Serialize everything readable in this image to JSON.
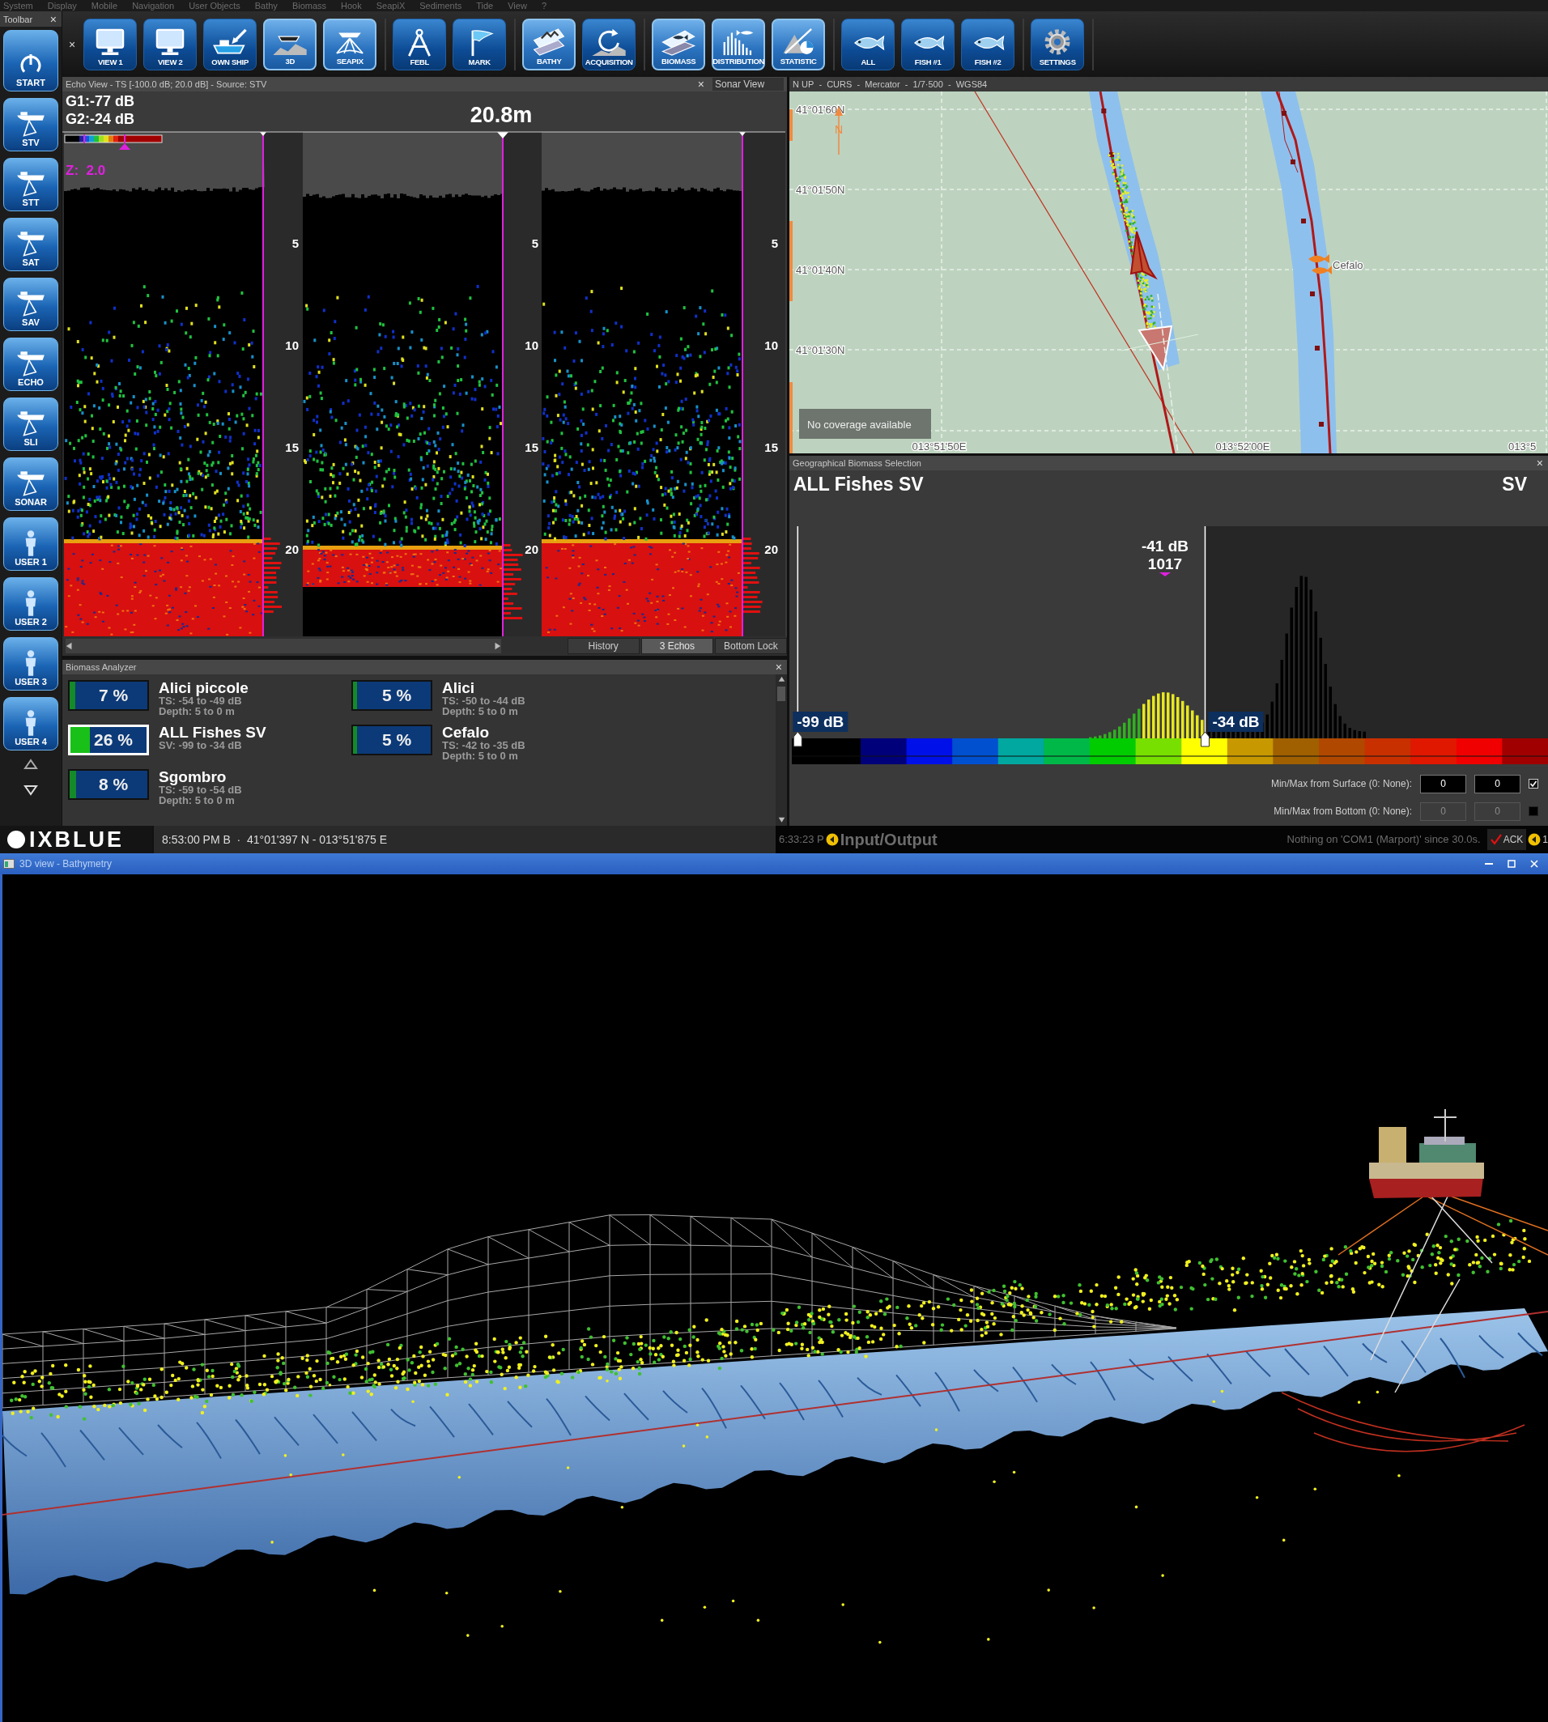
{
  "menu": [
    "System",
    "Display",
    "Mobile",
    "Navigation",
    "User Objects",
    "Bathy",
    "Biomass",
    "Hook",
    "SeapiX",
    "Sediments",
    "Tide",
    "View",
    "?"
  ],
  "side_toolbar": {
    "title": "Toolbar",
    "close": "×",
    "start": "START",
    "buttons": [
      {
        "label": "STV",
        "kind": "sonar"
      },
      {
        "label": "STT",
        "kind": "sonar"
      },
      {
        "label": "SAT",
        "kind": "sonar"
      },
      {
        "label": "SAV",
        "kind": "sonar"
      },
      {
        "label": "ECHO",
        "kind": "sonar"
      },
      {
        "label": "SLI",
        "kind": "sonar"
      },
      {
        "label": "SONAR",
        "kind": "sonar"
      },
      {
        "label": "USER 1",
        "kind": "user"
      },
      {
        "label": "USER 2",
        "kind": "user"
      },
      {
        "label": "USER 3",
        "kind": "user"
      },
      {
        "label": "USER 4",
        "kind": "user"
      }
    ]
  },
  "main_toolbar": {
    "close": "×",
    "groups": [
      [
        {
          "label": "VIEW 1",
          "kind": "monitor",
          "selected": false
        },
        {
          "label": "VIEW 2",
          "kind": "monitor",
          "selected": false
        },
        {
          "label": "OWN SHIP",
          "kind": "ship",
          "selected": false
        },
        {
          "label": "3D",
          "kind": "boat3d",
          "selected": true
        },
        {
          "label": "SEAPIX",
          "kind": "seapix",
          "selected": true
        }
      ],
      [
        {
          "label": "FEBL",
          "kind": "compass",
          "selected": false
        },
        {
          "label": "MARK",
          "kind": "flag",
          "selected": false
        }
      ],
      [
        {
          "label": "BATHY",
          "kind": "bathy",
          "selected": true
        },
        {
          "label": "ACQUISITION",
          "kind": "acquisition",
          "selected": false
        }
      ],
      [
        {
          "label": "BIOMASS",
          "kind": "biomass",
          "selected": true
        },
        {
          "label": "DISTRIBUTION",
          "kind": "distribution",
          "selected": true
        },
        {
          "label": "STATISTIC",
          "kind": "statistic",
          "selected": true
        }
      ],
      [
        {
          "label": "ALL",
          "kind": "fish",
          "selected": false
        },
        {
          "label": "FISH #1",
          "kind": "fish",
          "selected": false
        },
        {
          "label": "FISH #2",
          "kind": "fish",
          "selected": false
        }
      ],
      [
        {
          "label": "SETTINGS",
          "kind": "gear",
          "selected": false
        }
      ]
    ]
  },
  "echo_view": {
    "title": "Echo View - TS [-100.0 dB; 20.0 dB] - Source: STV",
    "close": "×",
    "sonar_tab": "Sonar View",
    "gain_1": "G1:-77 dB",
    "gain_2": "G2:-24 dB",
    "zoom": "Z:  2.0",
    "range": "20.8m",
    "columns": [
      {
        "depth_labels": [
          "5",
          "10",
          "15",
          "20"
        ]
      },
      {
        "depth_labels": [
          "5",
          "10",
          "15",
          "20"
        ]
      },
      {
        "depth_labels": [
          "5",
          "10",
          "15",
          "20"
        ]
      }
    ],
    "tabs": [
      {
        "label": "History",
        "selected": false
      },
      {
        "label": "3 Echos",
        "selected": true
      },
      {
        "label": "Bottom Lock",
        "selected": false
      }
    ]
  },
  "biomass_analyzer": {
    "title": "Biomass Analyzer",
    "close": "×",
    "items": [
      {
        "percent": "7 %",
        "level": 0.07,
        "name": "Alici piccole",
        "details": [
          "TS: -54 to -49 dB",
          "Depth: 5 to 0 m"
        ],
        "selected": false
      },
      {
        "percent": "26 %",
        "level": 0.26,
        "name": "ALL Fishes SV",
        "details": [
          "SV: -99 to -34 dB"
        ],
        "selected": true
      },
      {
        "percent": "8 %",
        "level": 0.08,
        "name": "Sgombro",
        "details": [
          "TS: -59 to -54 dB",
          "Depth: 5 to 0 m"
        ],
        "selected": false
      },
      {
        "percent": "5 %",
        "level": 0.05,
        "name": "Alici",
        "details": [
          "TS: -50 to -44 dB",
          "Depth: 5 to 0 m"
        ],
        "selected": false
      },
      {
        "percent": "5 %",
        "level": 0.05,
        "name": "Cefalo",
        "details": [
          "TS: -42 to -35 dB",
          "Depth: 5 to 0 m"
        ],
        "selected": false
      }
    ]
  },
  "map": {
    "header": "N UP  -  CURS  -  Mercator  -  1/7·500  -  WGS84",
    "lat_labels": [
      "41°01'60N",
      "41°01'50N",
      "41°01'40N",
      "41°01'30N"
    ],
    "lon_labels": [
      "013°51'50E",
      "013°52'00E",
      "013°5"
    ],
    "north_label": "N",
    "marker_label": "Cefalo",
    "notice": "No coverage available"
  },
  "geo_selection": {
    "title": "Geographical Biomass Selection",
    "close": "×",
    "heading": "ALL Fishes SV",
    "unit": "SV",
    "cursor_value": "-41 dB",
    "cursor_count": "1017",
    "handles": [
      {
        "label": "-99 dB",
        "level": 0.011
      },
      {
        "label": "-34 dB",
        "level": 0.548
      }
    ],
    "surface": {
      "label": "Min/Max from Surface (0: None):",
      "min": "0",
      "max": "0",
      "checked": true,
      "disabled": false
    },
    "bottom": {
      "label": "Min/Max from Bottom (0: None):",
      "min": "0",
      "max": "0",
      "checked": false,
      "disabled": true
    }
  },
  "status_bar": {
    "logo": "IXBLUE",
    "info": "8:53:00 PM B  ·  41°01'397 N - 013°51'875 E",
    "io_time": "6:33:23 P",
    "io_title": "Input/Output",
    "message": "Nothing on 'COM1 (Marport)' since 30.0s.",
    "ack": "ACK",
    "alert_count": "1"
  },
  "view3d": {
    "title": "3D view - Bathymetry"
  }
}
